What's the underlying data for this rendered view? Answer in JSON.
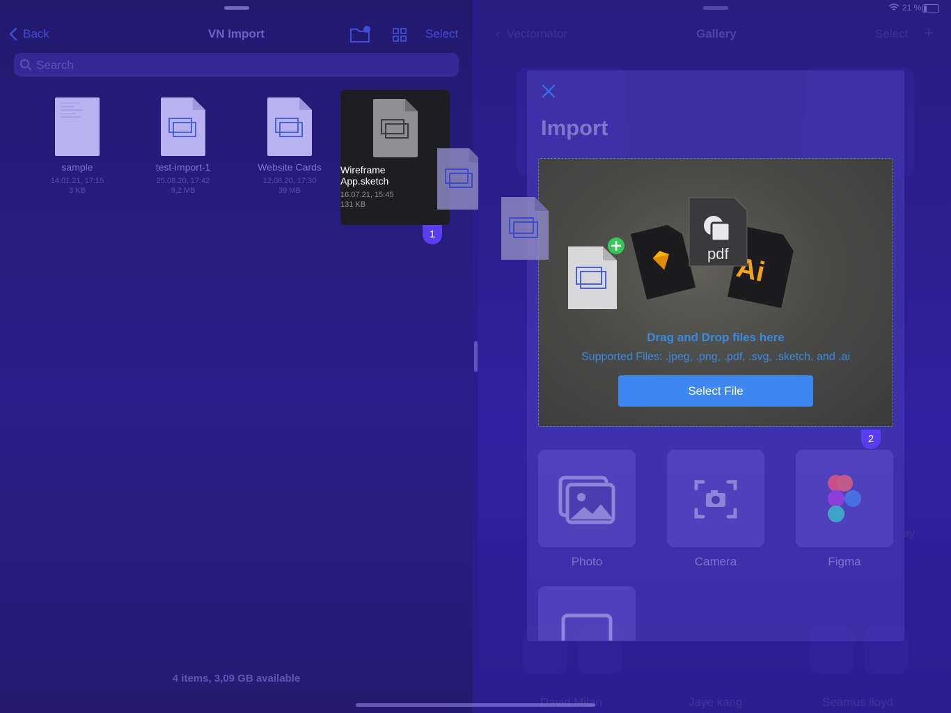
{
  "left": {
    "back_label": "Back",
    "title": "VN Import",
    "select_label": "Select",
    "search_placeholder": "Search",
    "files": [
      {
        "name": "sample",
        "date": "14.01.21, 17:15",
        "size": "3 KB",
        "icon": "text-document-icon"
      },
      {
        "name": "test-import-1",
        "date": "25.08.20, 17:42",
        "size": "9,2 MB",
        "icon": "vectornator-document-icon"
      },
      {
        "name": "Website Cards",
        "date": "12.08.20, 17:30",
        "size": "39 MB",
        "icon": "vectornator-document-icon"
      },
      {
        "name_line1": "Wireframe",
        "name_line2": "App.sketch",
        "date": "16.07.21, 15:45",
        "size": "131 KB",
        "icon": "vectornator-document-icon",
        "selected": true
      }
    ],
    "footer": "4 items, 3,09 GB available",
    "drag_badge": "1"
  },
  "right": {
    "status": {
      "battery": "21 %"
    },
    "back_label": "Vectornator",
    "title": "Gallery",
    "select_label": "Select",
    "plus_label": "+",
    "import": {
      "title": "Import",
      "drop_title": "Drag and Drop files here",
      "drop_subtitle": "Supported Files: .jpeg, .png, .pdf, .svg, .sketch, and .ai",
      "select_button": "Select File",
      "pdf_label": "pdf",
      "ai_label": "Ai",
      "drop_badge": "2",
      "sources": [
        {
          "label": "Photo",
          "icon": "photo-icon"
        },
        {
          "label": "Camera",
          "icon": "camera-icon"
        },
        {
          "label": "Figma",
          "icon": "figma-icon"
        }
      ]
    },
    "gallery_names": [
      "David Milan",
      "Jaye kang",
      "Seamus lloyd"
    ],
    "side_fragment": "ay"
  },
  "colors": {
    "accent": "#3e86f0",
    "badge": "#5b3df0",
    "add_badge": "#34c759",
    "ai": "#f7a21b"
  }
}
